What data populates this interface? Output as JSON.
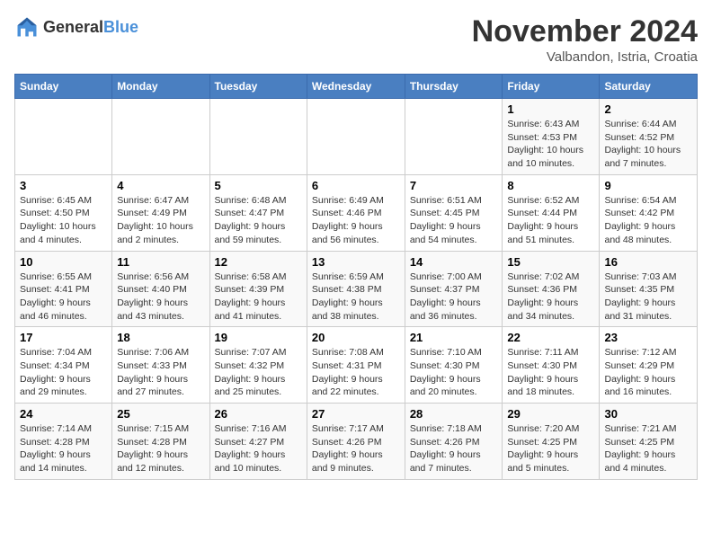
{
  "logo": {
    "text_general": "General",
    "text_blue": "Blue"
  },
  "title": "November 2024",
  "subtitle": "Valbandon, Istria, Croatia",
  "days_of_week": [
    "Sunday",
    "Monday",
    "Tuesday",
    "Wednesday",
    "Thursday",
    "Friday",
    "Saturday"
  ],
  "weeks": [
    [
      {
        "day": "",
        "info": ""
      },
      {
        "day": "",
        "info": ""
      },
      {
        "day": "",
        "info": ""
      },
      {
        "day": "",
        "info": ""
      },
      {
        "day": "",
        "info": ""
      },
      {
        "day": "1",
        "info": "Sunrise: 6:43 AM\nSunset: 4:53 PM\nDaylight: 10 hours and 10 minutes."
      },
      {
        "day": "2",
        "info": "Sunrise: 6:44 AM\nSunset: 4:52 PM\nDaylight: 10 hours and 7 minutes."
      }
    ],
    [
      {
        "day": "3",
        "info": "Sunrise: 6:45 AM\nSunset: 4:50 PM\nDaylight: 10 hours and 4 minutes."
      },
      {
        "day": "4",
        "info": "Sunrise: 6:47 AM\nSunset: 4:49 PM\nDaylight: 10 hours and 2 minutes."
      },
      {
        "day": "5",
        "info": "Sunrise: 6:48 AM\nSunset: 4:47 PM\nDaylight: 9 hours and 59 minutes."
      },
      {
        "day": "6",
        "info": "Sunrise: 6:49 AM\nSunset: 4:46 PM\nDaylight: 9 hours and 56 minutes."
      },
      {
        "day": "7",
        "info": "Sunrise: 6:51 AM\nSunset: 4:45 PM\nDaylight: 9 hours and 54 minutes."
      },
      {
        "day": "8",
        "info": "Sunrise: 6:52 AM\nSunset: 4:44 PM\nDaylight: 9 hours and 51 minutes."
      },
      {
        "day": "9",
        "info": "Sunrise: 6:54 AM\nSunset: 4:42 PM\nDaylight: 9 hours and 48 minutes."
      }
    ],
    [
      {
        "day": "10",
        "info": "Sunrise: 6:55 AM\nSunset: 4:41 PM\nDaylight: 9 hours and 46 minutes."
      },
      {
        "day": "11",
        "info": "Sunrise: 6:56 AM\nSunset: 4:40 PM\nDaylight: 9 hours and 43 minutes."
      },
      {
        "day": "12",
        "info": "Sunrise: 6:58 AM\nSunset: 4:39 PM\nDaylight: 9 hours and 41 minutes."
      },
      {
        "day": "13",
        "info": "Sunrise: 6:59 AM\nSunset: 4:38 PM\nDaylight: 9 hours and 38 minutes."
      },
      {
        "day": "14",
        "info": "Sunrise: 7:00 AM\nSunset: 4:37 PM\nDaylight: 9 hours and 36 minutes."
      },
      {
        "day": "15",
        "info": "Sunrise: 7:02 AM\nSunset: 4:36 PM\nDaylight: 9 hours and 34 minutes."
      },
      {
        "day": "16",
        "info": "Sunrise: 7:03 AM\nSunset: 4:35 PM\nDaylight: 9 hours and 31 minutes."
      }
    ],
    [
      {
        "day": "17",
        "info": "Sunrise: 7:04 AM\nSunset: 4:34 PM\nDaylight: 9 hours and 29 minutes."
      },
      {
        "day": "18",
        "info": "Sunrise: 7:06 AM\nSunset: 4:33 PM\nDaylight: 9 hours and 27 minutes."
      },
      {
        "day": "19",
        "info": "Sunrise: 7:07 AM\nSunset: 4:32 PM\nDaylight: 9 hours and 25 minutes."
      },
      {
        "day": "20",
        "info": "Sunrise: 7:08 AM\nSunset: 4:31 PM\nDaylight: 9 hours and 22 minutes."
      },
      {
        "day": "21",
        "info": "Sunrise: 7:10 AM\nSunset: 4:30 PM\nDaylight: 9 hours and 20 minutes."
      },
      {
        "day": "22",
        "info": "Sunrise: 7:11 AM\nSunset: 4:30 PM\nDaylight: 9 hours and 18 minutes."
      },
      {
        "day": "23",
        "info": "Sunrise: 7:12 AM\nSunset: 4:29 PM\nDaylight: 9 hours and 16 minutes."
      }
    ],
    [
      {
        "day": "24",
        "info": "Sunrise: 7:14 AM\nSunset: 4:28 PM\nDaylight: 9 hours and 14 minutes."
      },
      {
        "day": "25",
        "info": "Sunrise: 7:15 AM\nSunset: 4:28 PM\nDaylight: 9 hours and 12 minutes."
      },
      {
        "day": "26",
        "info": "Sunrise: 7:16 AM\nSunset: 4:27 PM\nDaylight: 9 hours and 10 minutes."
      },
      {
        "day": "27",
        "info": "Sunrise: 7:17 AM\nSunset: 4:26 PM\nDaylight: 9 hours and 9 minutes."
      },
      {
        "day": "28",
        "info": "Sunrise: 7:18 AM\nSunset: 4:26 PM\nDaylight: 9 hours and 7 minutes."
      },
      {
        "day": "29",
        "info": "Sunrise: 7:20 AM\nSunset: 4:25 PM\nDaylight: 9 hours and 5 minutes."
      },
      {
        "day": "30",
        "info": "Sunrise: 7:21 AM\nSunset: 4:25 PM\nDaylight: 9 hours and 4 minutes."
      }
    ]
  ]
}
